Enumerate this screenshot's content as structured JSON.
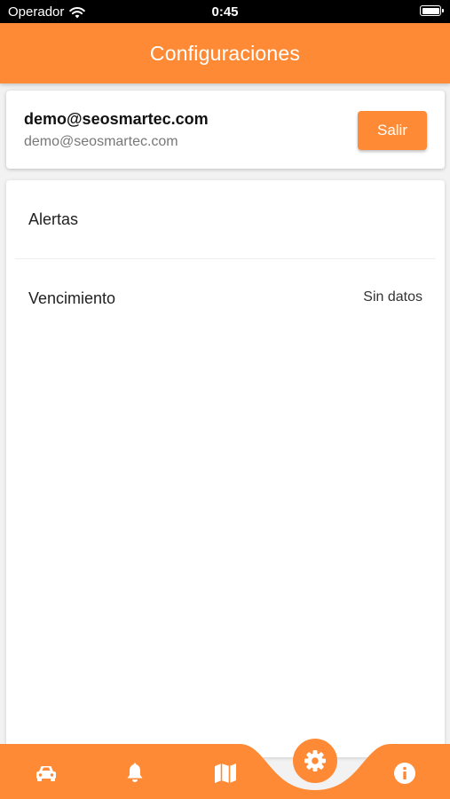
{
  "status_bar": {
    "carrier": "Operador",
    "time": "0:45"
  },
  "app_bar": {
    "title": "Configuraciones"
  },
  "account": {
    "email": "demo@seosmartec.com",
    "subtitle": "demo@seosmartec.com",
    "logout_label": "Salir"
  },
  "settings": {
    "items": [
      {
        "label": "Alertas",
        "value": ""
      },
      {
        "label": "Vencimiento",
        "value": "Sin datos"
      }
    ]
  },
  "bottom_nav": {
    "items": [
      "car-icon",
      "bell-icon",
      "map-icon",
      "gear-icon",
      "info-icon"
    ],
    "active": "gear-icon"
  },
  "colors": {
    "accent": "#ff8a35",
    "background": "#f2f2f2",
    "card": "#ffffff"
  }
}
